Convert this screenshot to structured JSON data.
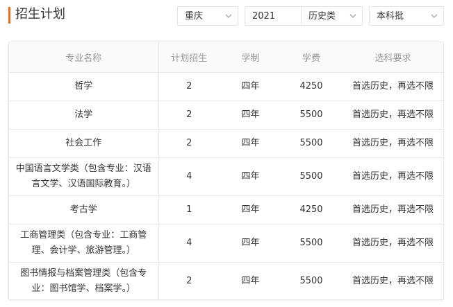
{
  "page": {
    "title": "招生计划"
  },
  "filters": [
    {
      "name": "province-select",
      "value": "重庆"
    },
    {
      "name": "year-select",
      "value": "2021"
    },
    {
      "name": "subject-select",
      "value": "历史类"
    },
    {
      "name": "batch-select",
      "value": "本科批"
    }
  ],
  "table": {
    "headers": [
      "专业名称",
      "计划招生",
      "学制",
      "学费",
      "选科要求"
    ],
    "rows": [
      {
        "major": "哲学",
        "plan": "2",
        "duration": "四年",
        "fee": "4250",
        "req": "首选历史，再选不限"
      },
      {
        "major": "法学",
        "plan": "2",
        "duration": "四年",
        "fee": "5500",
        "req": "首选历史，再选不限"
      },
      {
        "major": "社会工作",
        "plan": "2",
        "duration": "四年",
        "fee": "5500",
        "req": "首选历史，再选不限"
      },
      {
        "major": "中国语言文学类（包含专业：汉语言文学、汉语国际教育。）",
        "plan": "4",
        "duration": "四年",
        "fee": "5500",
        "req": "首选历史，再选不限"
      },
      {
        "major": "考古学",
        "plan": "1",
        "duration": "四年",
        "fee": "4250",
        "req": "首选历史，再选不限"
      },
      {
        "major": "工商管理类（包含专业：工商管理、会计学、旅游管理。）",
        "plan": "4",
        "duration": "四年",
        "fee": "5500",
        "req": "首选历史，再选不限"
      },
      {
        "major": "图书情报与档案管理类（包含专业：图书馆学、档案学。）",
        "plan": "2",
        "duration": "四年",
        "fee": "5500",
        "req": "首选历史，再选不限"
      }
    ]
  }
}
